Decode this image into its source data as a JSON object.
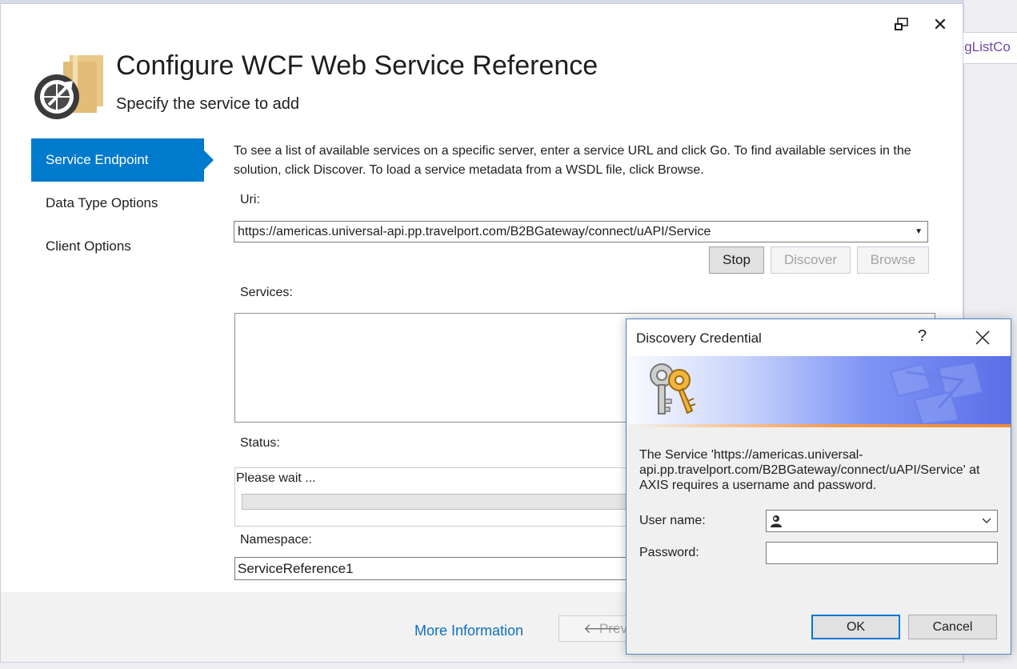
{
  "background": {
    "editor_tab_fragment": "ingListCo"
  },
  "wizard": {
    "title": "Configure WCF Web Service Reference",
    "subtitle": "Specify the service to add",
    "close_glyph": "✕",
    "nav": [
      {
        "label": "Service Endpoint"
      },
      {
        "label": "Data Type Options"
      },
      {
        "label": "Client Options"
      }
    ],
    "description": "To see a list of available services on a specific server, enter a service URL and click Go. To find available services in the solution, click Discover.  To load a service metadata from a WSDL file, click Browse.",
    "uri_label": "Uri:",
    "uri_value": "https://americas.universal-api.pp.travelport.com/B2BGateway/connect/uAPI/Service",
    "stop_label": "Stop",
    "discover_label": "Discover",
    "browse_label": "Browse",
    "services_label": "Services:",
    "status_label": "Status:",
    "status_text": "Please wait ...",
    "namespace_label": "Namespace:",
    "namespace_value": "ServiceReference1",
    "footer": {
      "more_info": "More Information",
      "prev_label": "Prev"
    },
    "colors": {
      "accent": "#007acc",
      "link": "#0e70c0"
    }
  },
  "dialog": {
    "title": "Discovery Credential",
    "help_glyph": "?",
    "message": "The Service 'https://americas.universal-api.pp.travelport.com/B2BGateway/connect/uAPI/Service' at AXIS requires a username and password.",
    "username_label": "User name:",
    "password_label": "Password:",
    "ok_label": "OK",
    "cancel_label": "Cancel"
  }
}
